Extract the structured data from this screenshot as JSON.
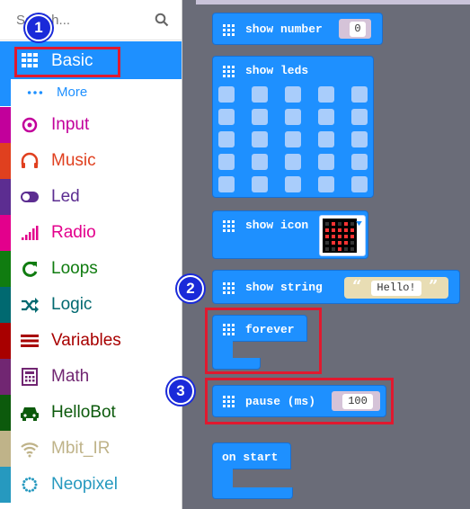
{
  "search": {
    "placeholder": "Search..."
  },
  "sidebar": {
    "basic": "Basic",
    "more": "More",
    "items": [
      {
        "label": "Input",
        "color": "#c2009b",
        "icon": "target-icon"
      },
      {
        "label": "Music",
        "color": "#e0401f",
        "icon": "headphones-icon"
      },
      {
        "label": "Led",
        "color": "#5c2d91",
        "icon": "toggle-icon"
      },
      {
        "label": "Radio",
        "color": "#e3008c",
        "icon": "signal-bars-icon"
      },
      {
        "label": "Loops",
        "color": "#107c10",
        "icon": "refresh-icon"
      },
      {
        "label": "Logic",
        "color": "#006970",
        "icon": "shuffle-icon"
      },
      {
        "label": "Variables",
        "color": "#a80000",
        "icon": "list-lines-icon"
      },
      {
        "label": "Math",
        "color": "#712672",
        "icon": "calculator-icon"
      },
      {
        "label": "HelloBot",
        "color": "#0c5a0c",
        "icon": "car-icon"
      },
      {
        "label": "Mbit_IR",
        "color": "#bfb389",
        "icon": "wifi-icon"
      },
      {
        "label": "Neopixel",
        "color": "#2699bf",
        "icon": "dotted-circle-icon"
      }
    ]
  },
  "badges": [
    "1",
    "2",
    "3"
  ],
  "blocks": {
    "show_number": "show number",
    "show_number_value": "0",
    "show_leds": "show leds",
    "show_icon": "show icon",
    "show_string": "show string",
    "show_string_value": "Hello!",
    "forever": "forever",
    "pause": "pause (ms)",
    "pause_value": "100",
    "on_start": "on start"
  }
}
